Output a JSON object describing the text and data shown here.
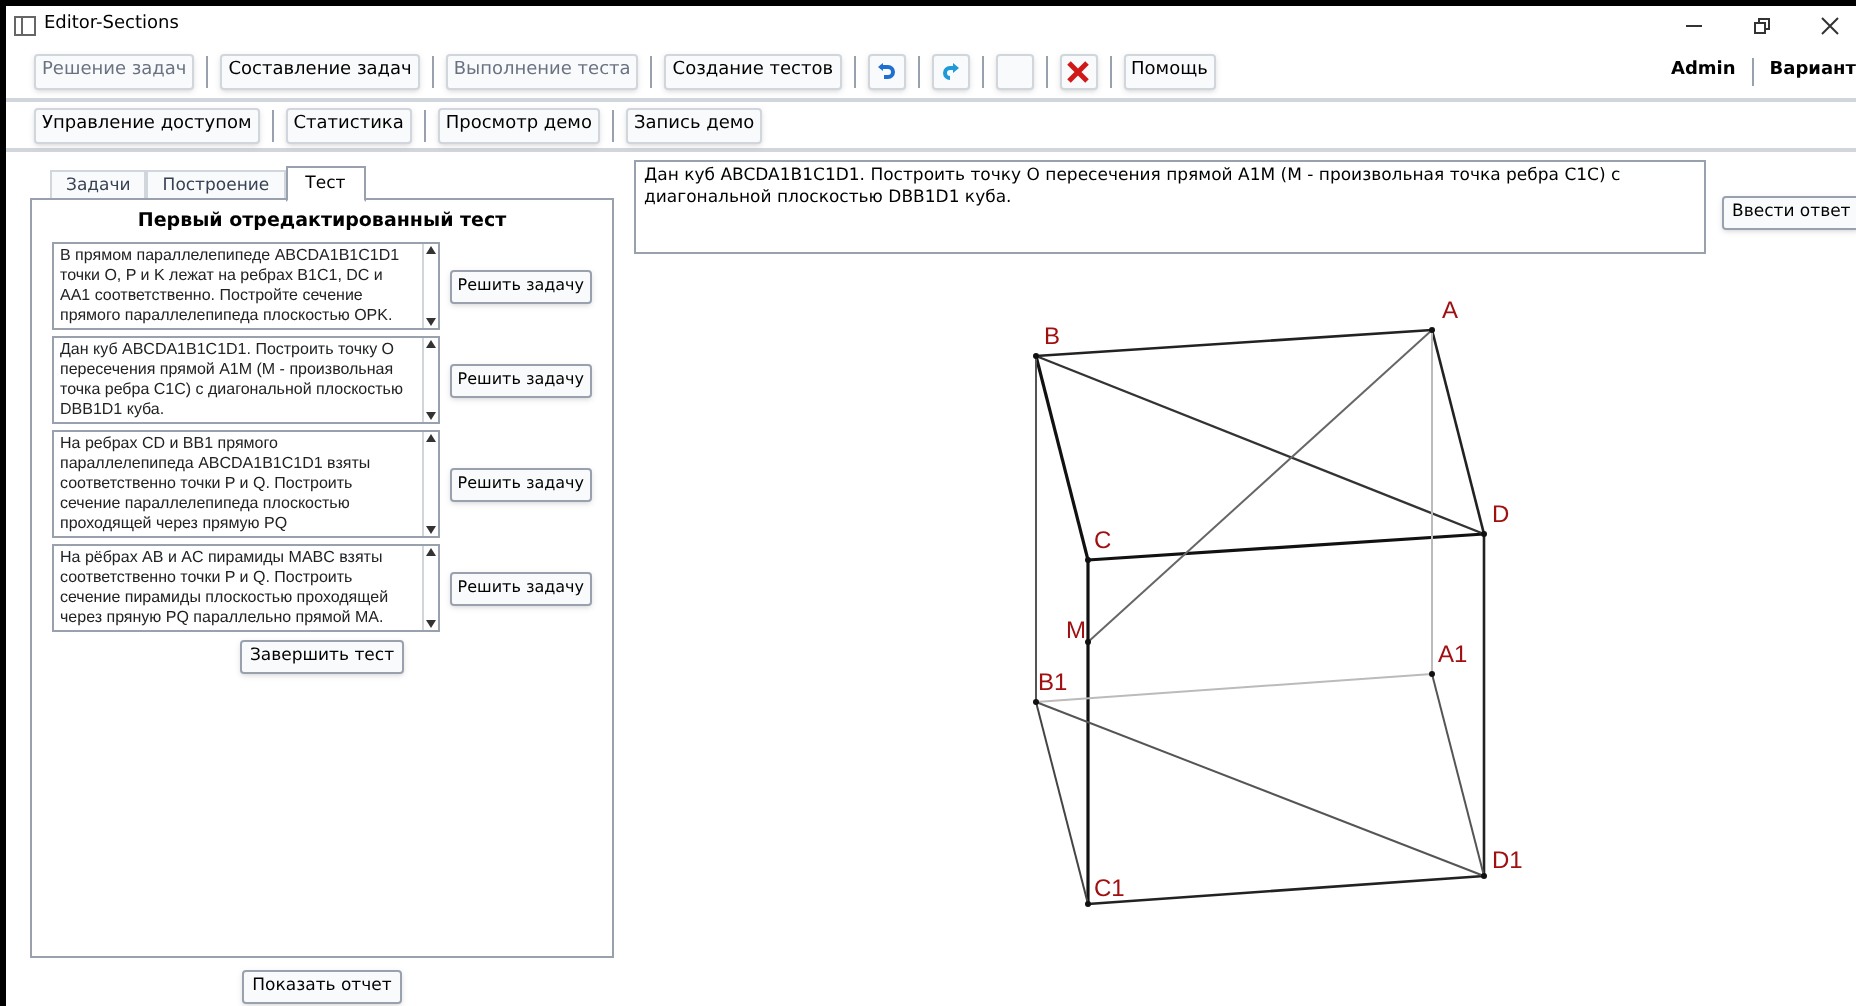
{
  "window": {
    "title": "Editor-Sections"
  },
  "toolbar": [
    {
      "kind": "text",
      "label": "Решение задач",
      "disabled": true
    },
    {
      "kind": "text",
      "label": "Составление задач",
      "disabled": false
    },
    {
      "kind": "text",
      "label": "Выполнение теста",
      "disabled": true
    },
    {
      "kind": "text",
      "label": "Создание тестов",
      "disabled": false
    },
    {
      "kind": "undo"
    },
    {
      "kind": "redo"
    },
    {
      "kind": "blank"
    },
    {
      "kind": "delete"
    },
    {
      "kind": "text",
      "label": "Помощь",
      "disabled": false
    }
  ],
  "user": "Admin",
  "variant": "Вариант",
  "toolbar2": [
    "Управление доступом",
    "Статистика",
    "Просмотр демо",
    "Запись демо"
  ],
  "tabs": [
    {
      "label": "Задачи",
      "selected": false
    },
    {
      "label": "Построение",
      "selected": false
    },
    {
      "label": "Тест",
      "selected": true
    }
  ],
  "test": {
    "title": "Первый отредактированный тест",
    "tasks": [
      {
        "text": "В прямом параллелепипеде  ABCDA1B1C1D1 точки  O, P  и  K лежат  на  ребрах  B1C1,  DC  и  AA1  соответственно. Постройте сечение прямого параллелепипеда плоскостью OPK.",
        "button": "Решить задачу"
      },
      {
        "text": "Дан куб ABCDA1B1C1D1. Построить точку O пересечения прямой A1M (M - произвольная точка ребра C1C) с диагональной плоскостью DBB1D1 куба.",
        "button": "Решить задачу"
      },
      {
        "text": "На ребрах CD и BB1 прямого параллелепипеда ABCDA1B1C1D1 взяты соответственно точки P и Q. Построить сечение параллелепипеда плоскостью проходящей через прямую PQ",
        "button": "Решить задачу"
      },
      {
        "text": "На рёбрах AB и AC пирамиды MABC взяты соответственно точки P и Q. Построить сечение пирамиды плоскостью проходящей через пряную PQ параллельно прямой MA.",
        "button": "Решить задачу"
      }
    ],
    "finish": "Завершить тест"
  },
  "report_button": "Показать отчет",
  "problem_text": "Дан куб ABCDA1B1C1D1. Построить точку O пересечения прямой A1M (M - произвольная точка ребра C1C) с диагональной плоскостью DBB1D1 куба.",
  "answer_button": "Ввести ответ",
  "drawing": {
    "points": [
      {
        "label": "B"
      },
      {
        "label": "A"
      },
      {
        "label": "D"
      },
      {
        "label": "C"
      },
      {
        "label": "M"
      },
      {
        "label": "B1"
      },
      {
        "label": "A1"
      },
      {
        "label": "C1"
      },
      {
        "label": "D1"
      }
    ]
  }
}
